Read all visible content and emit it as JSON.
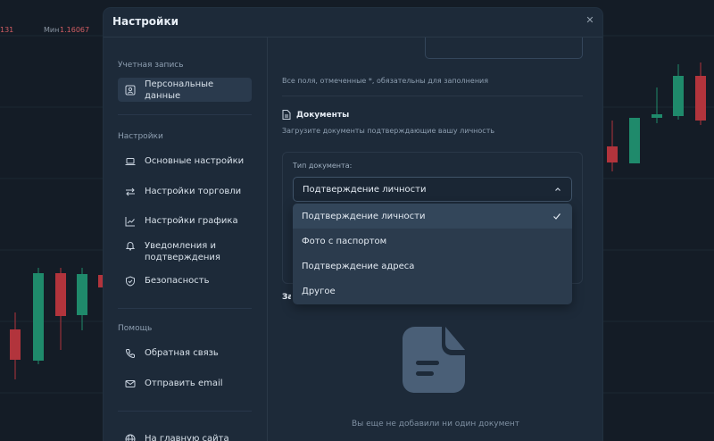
{
  "ticker": {
    "left_value": "131",
    "min_label": "Мин",
    "min_value": "1.16067"
  },
  "modal": {
    "title": "Настройки",
    "close_icon": "close-icon"
  },
  "sidebar": {
    "groups": [
      {
        "title": "Учетная запись"
      },
      {
        "title": "Настройки"
      },
      {
        "title": "Помощь"
      }
    ],
    "items": [
      {
        "label": "Персональные данные",
        "icon": "user-card-icon",
        "active": true
      },
      {
        "label": "Основные настройки",
        "icon": "laptop-icon"
      },
      {
        "label": "Настройки торговли",
        "icon": "arrows-swap-icon"
      },
      {
        "label": "Настройки графика",
        "icon": "line-chart-icon"
      },
      {
        "label": "Уведомления и подтверждения",
        "icon": "bell-icon"
      },
      {
        "label": "Безопасность",
        "icon": "shield-icon"
      },
      {
        "label": "Обратная связь",
        "icon": "phone-icon"
      },
      {
        "label": "Отправить email",
        "icon": "mail-icon"
      },
      {
        "label": "На главную сайта",
        "icon": "globe-icon"
      }
    ]
  },
  "content": {
    "required_note": "Все поля, отмеченные *, обязательны для заполнения",
    "documents_title": "Документы",
    "documents_subtitle": "Загрузите документы подтверждающие вашу личность",
    "doc_type_label": "Тип документа:",
    "doc_type_value": "Подтверждение личности",
    "doc_type_options": [
      {
        "label": "Подтверждение личности",
        "selected": true
      },
      {
        "label": "Фото с паспортом"
      },
      {
        "label": "Подтверждение адреса"
      },
      {
        "label": "Другое"
      }
    ],
    "hidden_label": "За",
    "empty_text": "Вы еще не добавили ни один документ"
  },
  "colors": {
    "background": "#141c26",
    "modal": "#1d2a39",
    "candle_up": "#1f8a6b",
    "candle_down": "#b2343c"
  }
}
